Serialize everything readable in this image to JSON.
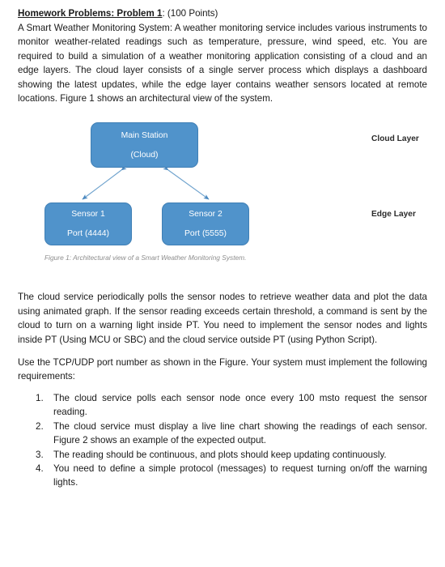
{
  "document": {
    "heading": {
      "bold_underlined": "Homework Problems: Problem 1",
      "rest": ": (100 Points)"
    },
    "intro_paragraph": "A Smart Weather Monitoring System: A weather monitoring service includes various instruments to monitor weather-related readings such as temperature, pressure, wind speed, etc. You are required to build a simulation of a weather monitoring application consisting of a cloud and an edge layers. The cloud layer consists of a single server process which displays a dashboard showing the latest updates, while the edge layer contains weather sensors located at remote locations. Figure 1 shows an architectural view of the system.",
    "middle_paragraph": "The cloud service periodically polls the sensor nodes to retrieve weather data and plot the data using animated graph. If the sensor reading exceeds certain threshold, a command is sent by the cloud to turn on a warning light inside PT. You need to implement the sensor nodes and lights inside PT (Using MCU or SBC) and the cloud service outside PT (using Python Script).",
    "requirements_intro": "Use the TCP/UDP port number as shown in the Figure. Your system must implement the following requirements:",
    "requirements": [
      {
        "number": "1.",
        "text": "The cloud service polls each sensor node once every 100 msto request the sensor reading."
      },
      {
        "number": "2.",
        "text": "The cloud service must display a live line chart showing the readings of each sensor. Figure 2 shows an example of the expected output."
      },
      {
        "number": "3.",
        "text": "The reading should be continuous, and plots should keep updating continuously."
      },
      {
        "number": "4.",
        "text": "You need to define a simple protocol (messages) to request turning on/off the warning lights."
      }
    ]
  },
  "figure": {
    "caption": "Figure 1: Architectural view of a Smart Weather Monitoring System.",
    "nodes": {
      "main_station": {
        "line1": "Main Station",
        "line2": "(Cloud)"
      },
      "sensor1": {
        "line1": "Sensor 1",
        "line2": "Port (4444)"
      },
      "sensor2": {
        "line1": "Sensor 2",
        "line2": "Port (5555)"
      }
    },
    "layer_labels": {
      "cloud": "Cloud Layer",
      "edge": "Edge Layer"
    },
    "colors": {
      "node_fill": "#5093cb",
      "node_border": "#3f7fb5",
      "node_text": "#ffffff",
      "connector": "#4a88bf",
      "caption_text": "#8d8d8d"
    }
  }
}
